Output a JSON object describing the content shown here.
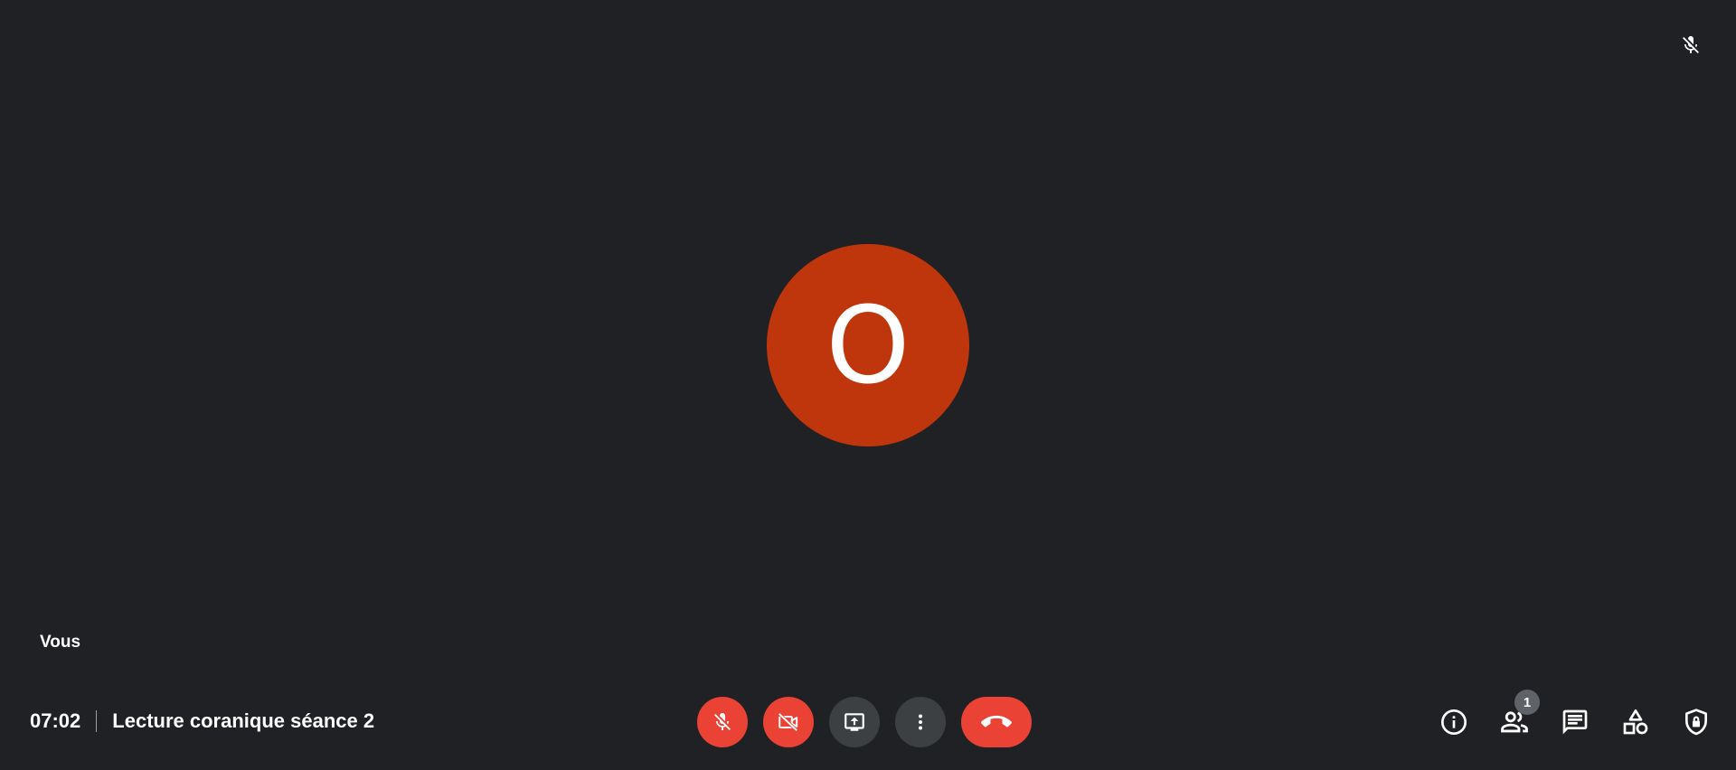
{
  "colors": {
    "background": "#202124",
    "avatar": "#bf360c",
    "danger": "#ea4335",
    "control_gray": "#3c4043",
    "badge": "#5f6368"
  },
  "tile": {
    "avatar_initial": "O",
    "self_label": "Vous",
    "mute_indicator_icon": "mic-off-icon"
  },
  "meeting": {
    "time": "07:02",
    "title": "Lecture coranique séance 2"
  },
  "controls": [
    {
      "name": "microphone-toggle",
      "icon": "mic-off-icon",
      "state": "off"
    },
    {
      "name": "camera-toggle",
      "icon": "videocam-off-icon",
      "state": "off"
    },
    {
      "name": "present-screen",
      "icon": "present-screen-icon"
    },
    {
      "name": "more-options",
      "icon": "more-vert-icon"
    },
    {
      "name": "leave-call",
      "icon": "call-end-icon"
    }
  ],
  "side_panel": {
    "info_icon": "info-icon",
    "people_icon": "people-icon",
    "participant_count": "1",
    "chat_icon": "chat-icon",
    "activities_icon": "activities-icon",
    "host_controls_icon": "shield-lock-icon"
  }
}
